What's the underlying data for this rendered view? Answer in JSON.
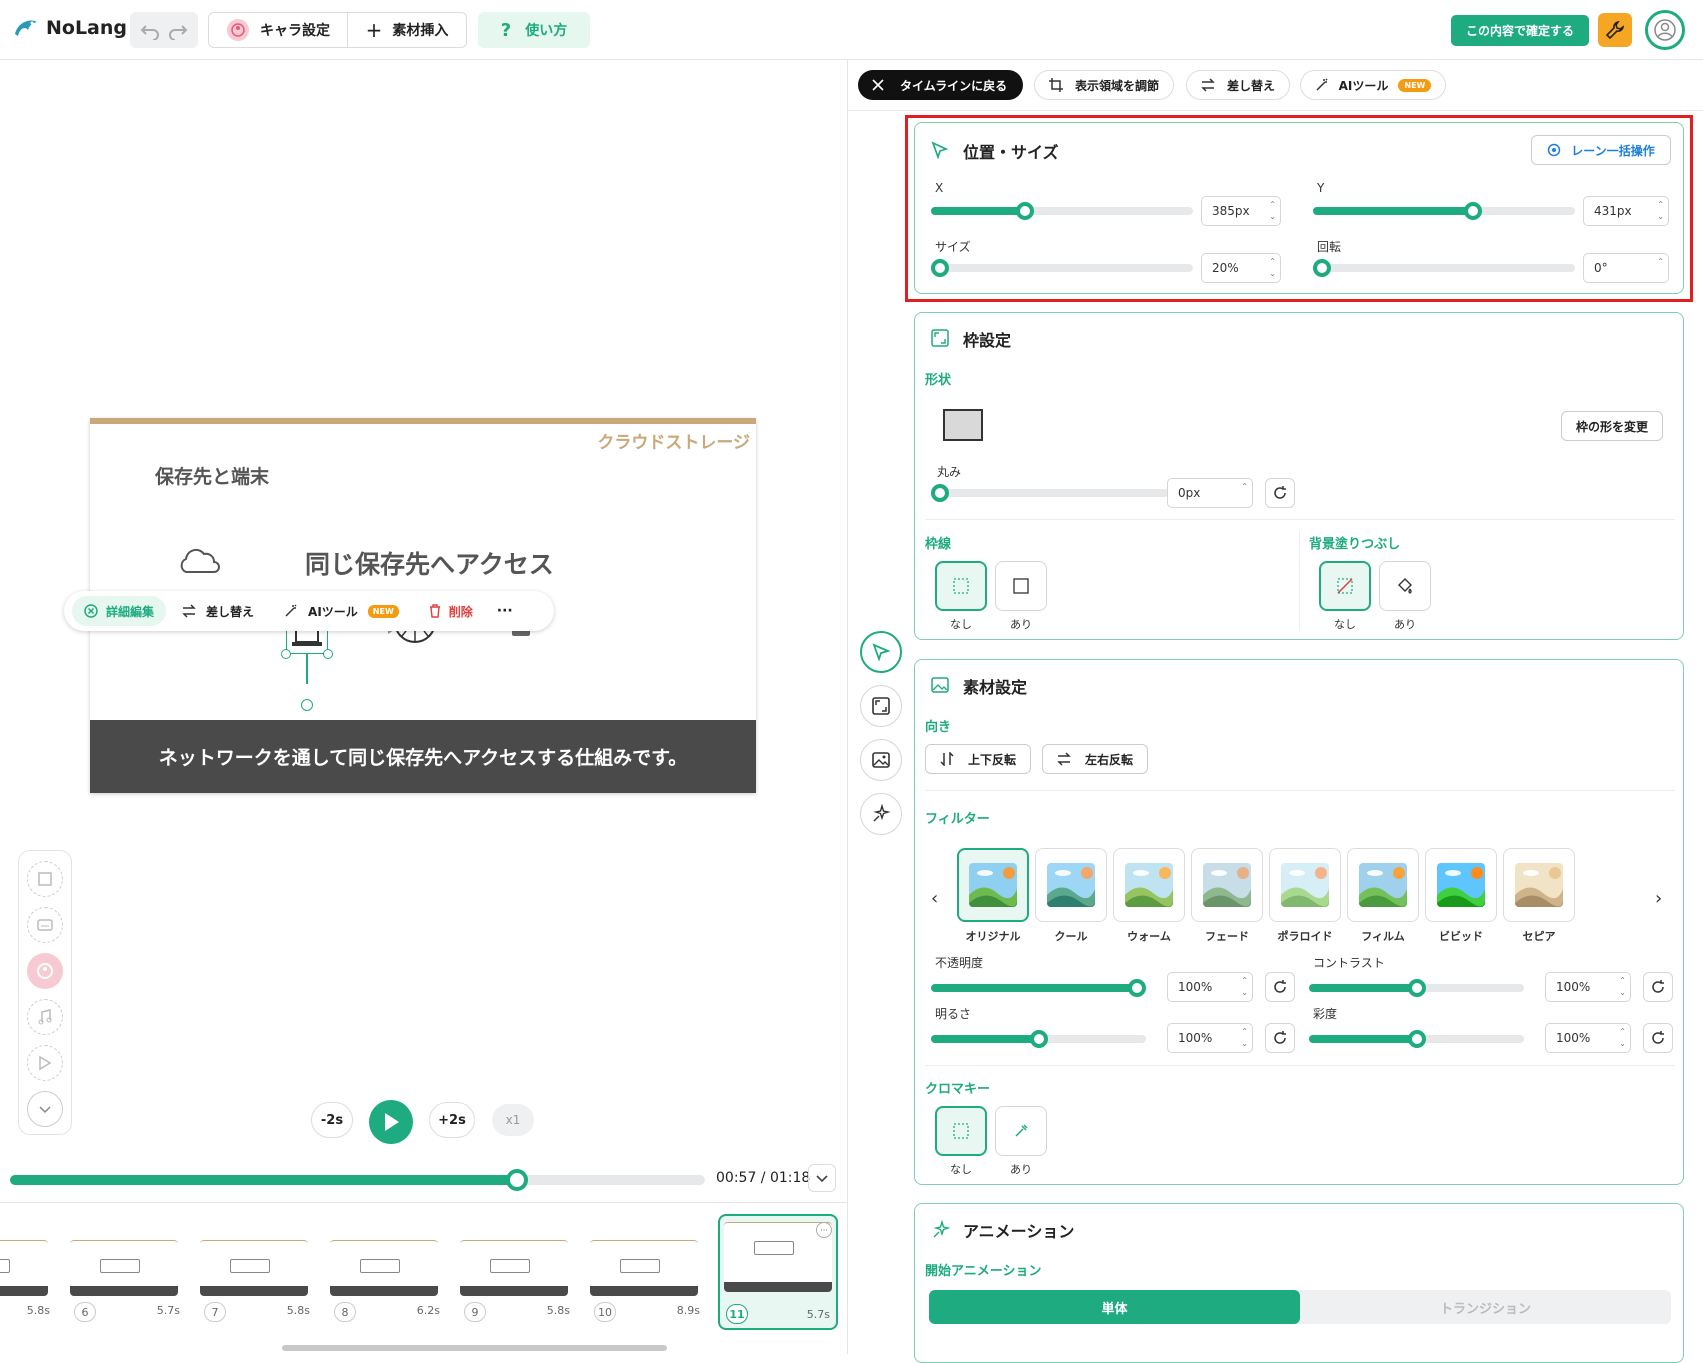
{
  "app": {
    "name": "NoLang"
  },
  "toolbar": {
    "chara_label": "キャラ設定",
    "insert_label": "素材挿入",
    "howto_label": "使い方",
    "confirm_label": "この内容で確定する"
  },
  "panel_tabs": {
    "back": "タイムラインに戻る",
    "crop": "表示領域を調節",
    "replace": "差し替え",
    "ai": "AIツール",
    "new_badge": "NEW"
  },
  "position": {
    "title": "位置・サイズ",
    "lane_button": "レーン一括操作",
    "x_label": "X",
    "x_value": "385px",
    "x_level": 0.35,
    "y_label": "Y",
    "y_value": "431px",
    "y_level": 0.62,
    "size_label": "サイズ",
    "size_value": "20%",
    "size_level": 0.0,
    "rot_label": "回転",
    "rot_value": "0°",
    "rot_level": 0.0
  },
  "frame": {
    "title": "枠設定",
    "shape_label": "形状",
    "change_shape": "枠の形を変更",
    "round_label": "丸み",
    "round_value": "0px",
    "round_level": 0.0,
    "border_label": "枠線",
    "fill_label": "背景塗りつぶし",
    "none": "なし",
    "yes": "あり"
  },
  "material": {
    "title": "素材設定",
    "direction_label": "向き",
    "flip_v": "上下反転",
    "flip_h": "左右反転",
    "filter_label": "フィルター",
    "filters": [
      "オリジナル",
      "クール",
      "ウォーム",
      "フェード",
      "ポラロイド",
      "フィルム",
      "ビビッド",
      "セピア"
    ],
    "opacity_label": "不透明度",
    "opacity_value": "100%",
    "opacity_level": 1.0,
    "contrast_label": "コントラスト",
    "contrast_value": "100%",
    "contrast_level": 0.5,
    "brightness_label": "明るさ",
    "brightness_value": "100%",
    "brightness_level": 0.5,
    "saturation_label": "彩度",
    "saturation_value": "100%",
    "saturation_level": 0.5,
    "chroma_label": "クロマキー",
    "none": "なし",
    "yes": "あり"
  },
  "animation": {
    "title": "アニメーション",
    "start_label": "開始アニメーション",
    "single": "単体",
    "transition": "トランジション"
  },
  "canvas": {
    "corner_title": "クラウドストレージ",
    "heading": "保存先と端末",
    "main_text": "同じ保存先へアクセス",
    "caption": "ネットワークを通して同じ保存先へアクセスする仕組みです。",
    "float_detail": "詳細編集",
    "float_replace": "差し替え",
    "float_ai": "AIツール",
    "float_new": "NEW",
    "float_delete": "削除",
    "float_more": "···"
  },
  "player": {
    "minus": "-2s",
    "plus": "+2s",
    "speed": "x1",
    "time": "00:57 / 01:18",
    "progress": 0.73
  },
  "timeline": [
    {
      "num": "",
      "dur": "5.8s"
    },
    {
      "num": "6",
      "dur": "5.7s"
    },
    {
      "num": "7",
      "dur": "5.8s"
    },
    {
      "num": "8",
      "dur": "6.2s"
    },
    {
      "num": "9",
      "dur": "5.8s"
    },
    {
      "num": "10",
      "dur": "8.9s"
    },
    {
      "num": "11",
      "dur": "5.7s"
    }
  ],
  "colors": {
    "accent": "#1dab7f",
    "highlight": "#e02020",
    "wrench": "#f5a623"
  }
}
